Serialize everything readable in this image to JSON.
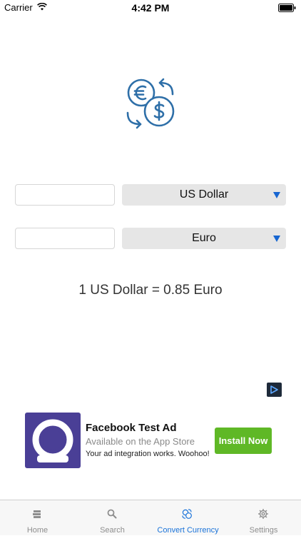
{
  "status_bar": {
    "carrier": "Carrier",
    "time": "4:42 PM"
  },
  "hero": {
    "icon": "currency-exchange-icon"
  },
  "converter": {
    "from": {
      "amount_value": "",
      "currency": "US Dollar"
    },
    "to": {
      "amount_value": "",
      "currency": "Euro"
    },
    "rate_text": "1 US Dollar = 0.85 Euro"
  },
  "ad": {
    "title": "Facebook Test Ad",
    "subtitle": "Available on the App Store",
    "body": "Your ad integration works. Woohoo!",
    "cta_label": "Install Now"
  },
  "tabs": [
    {
      "label": "Home",
      "icon": "home-icon",
      "active": false
    },
    {
      "label": "Search",
      "icon": "search-icon",
      "active": false
    },
    {
      "label": "Convert Currency",
      "icon": "convert-currency-icon",
      "active": true
    },
    {
      "label": "Settings",
      "icon": "gear-icon",
      "active": false
    }
  ],
  "colors": {
    "accent": "#1a73d9",
    "icon_blue": "#2e6fa8",
    "cta_green": "#5fb826",
    "ad_logo_purple": "#4a3f96",
    "select_background": "#e6e6e6"
  }
}
